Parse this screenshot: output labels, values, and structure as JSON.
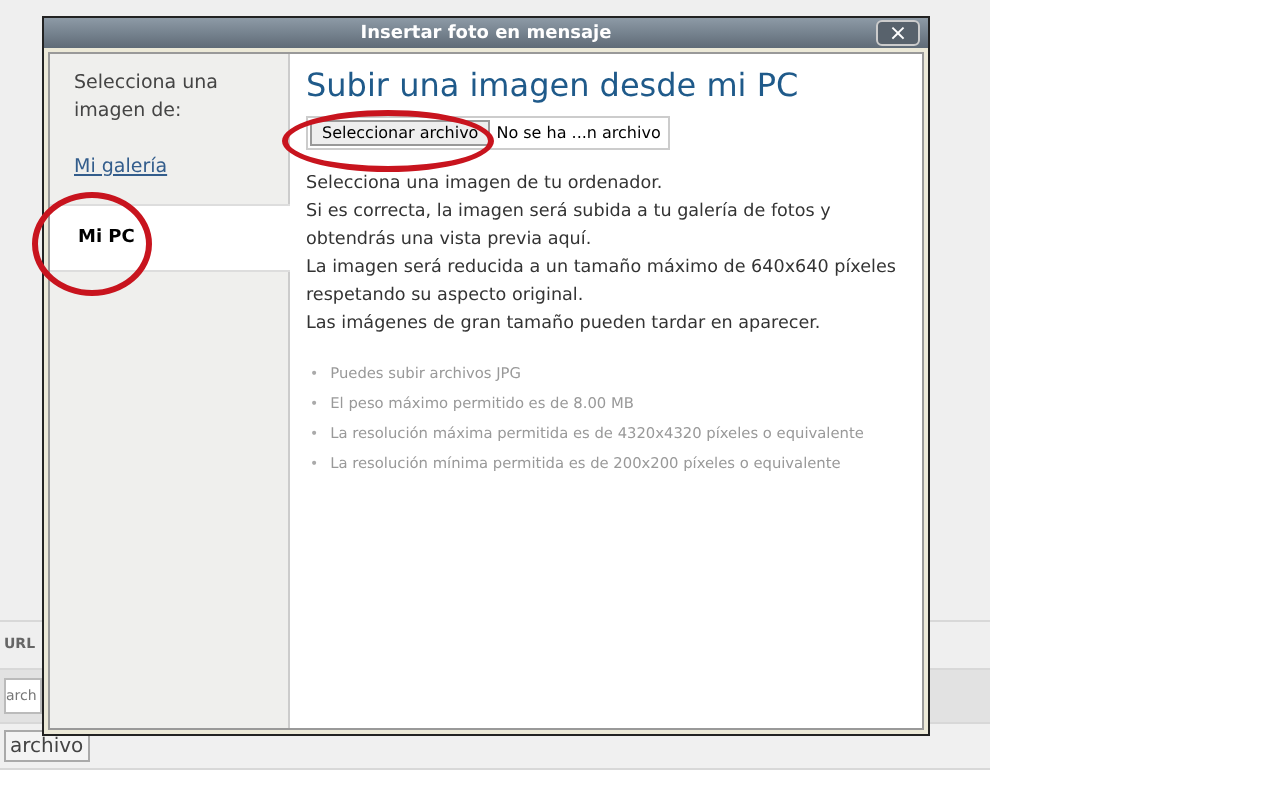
{
  "background": {
    "url_label": "URL",
    "field_value": "arch",
    "button_label": "archivo"
  },
  "dialog": {
    "title": "Insertar foto en mensaje",
    "close_label": "×"
  },
  "sidebar": {
    "heading": "Selecciona una imagen de:",
    "items": [
      {
        "label": "Mi galería",
        "selected": false,
        "circled": false
      },
      {
        "label": "Mi PC",
        "selected": true,
        "circled": true
      }
    ]
  },
  "main": {
    "title": "Subir una imagen desde mi PC",
    "file_button": {
      "label": "Seleccionar archivo",
      "circled": true
    },
    "file_status": "No se ha ...n archivo",
    "paragraphs": [
      "Selecciona una imagen de tu ordenador.",
      "Si es correcta, la imagen será subida a tu galería de fotos y obtendrás una vista previa aquí.",
      "La imagen será reducida a un tamaño máximo de 640x640 píxeles respetando su aspecto original.",
      "Las imágenes de gran tamaño pueden tardar en aparecer."
    ],
    "rule_marker": "•",
    "rules": [
      "Puedes subir archivos JPG",
      "El peso máximo permitido es de 8.00 MB",
      "La resolución máxima permitida es de 4320x4320 píxeles o equivalente",
      "La resolución mínima permitida es de 200x200 píxeles o equivalente"
    ]
  }
}
